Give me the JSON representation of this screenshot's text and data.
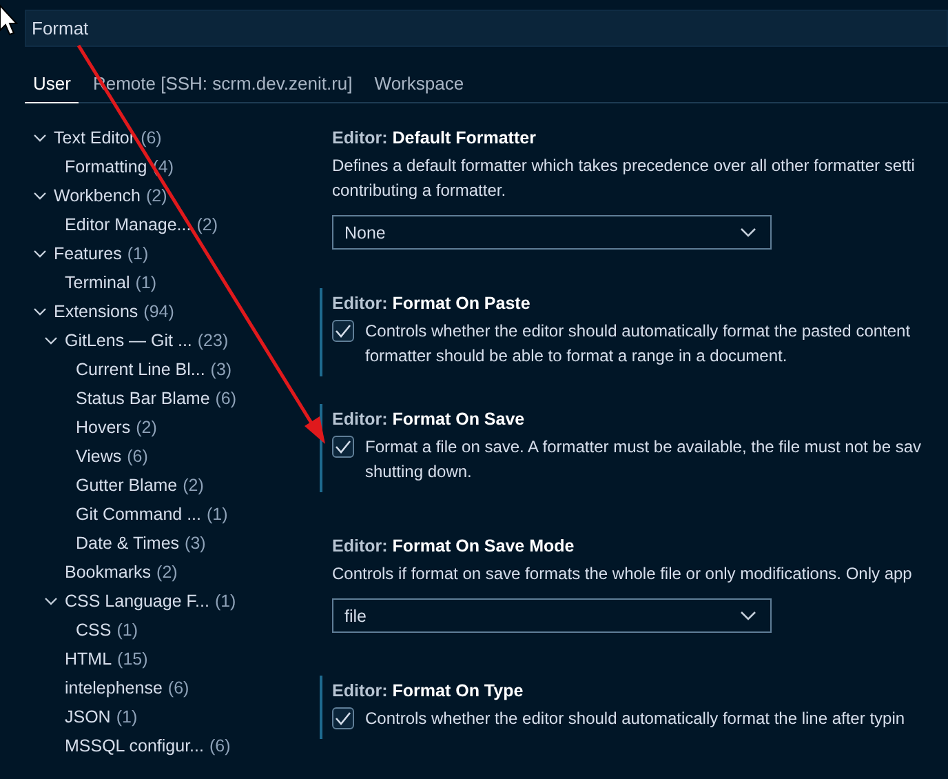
{
  "search": {
    "value": "Format"
  },
  "tabs": [
    {
      "label": "User",
      "selected": true
    },
    {
      "label": "Remote [SSH: scrm.dev.zenit.ru]",
      "selected": false
    },
    {
      "label": "Workspace",
      "selected": false
    }
  ],
  "tree": [
    {
      "label": "Text Editor",
      "count": "(6)",
      "expanded": true,
      "children": [
        {
          "label": "Formatting",
          "count": "(4)"
        }
      ]
    },
    {
      "label": "Workbench",
      "count": "(2)",
      "expanded": true,
      "children": [
        {
          "label": "Editor Manage...",
          "count": "(2)"
        }
      ]
    },
    {
      "label": "Features",
      "count": "(1)",
      "expanded": true,
      "children": [
        {
          "label": "Terminal",
          "count": "(1)"
        }
      ]
    },
    {
      "label": "Extensions",
      "count": "(94)",
      "expanded": true,
      "children": [
        {
          "label": "GitLens — Git ...",
          "count": "(23)",
          "expanded": true,
          "children": [
            {
              "label": "Current Line Bl...",
              "count": "(3)"
            },
            {
              "label": "Status Bar Blame",
              "count": "(6)"
            },
            {
              "label": "Hovers",
              "count": "(2)"
            },
            {
              "label": "Views",
              "count": "(6)"
            },
            {
              "label": "Gutter Blame",
              "count": "(2)"
            },
            {
              "label": "Git Command ...",
              "count": "(1)"
            },
            {
              "label": "Date & Times",
              "count": "(3)"
            }
          ]
        },
        {
          "label": "Bookmarks",
          "count": "(2)"
        },
        {
          "label": "CSS Language F...",
          "count": "(1)",
          "expanded": true,
          "children": [
            {
              "label": "CSS",
              "count": "(1)"
            }
          ]
        },
        {
          "label": "HTML",
          "count": "(15)"
        },
        {
          "label": "intelephense",
          "count": "(6)"
        },
        {
          "label": "JSON",
          "count": "(1)"
        },
        {
          "label": "MSSQL configur...",
          "count": "(6)"
        }
      ]
    }
  ],
  "settings": [
    {
      "kind": "select",
      "category": "Editor:",
      "name": "Default Formatter",
      "modified": false,
      "description": [
        "Defines a default formatter which takes precedence over all other formatter setti",
        "contributing a formatter."
      ],
      "value": "None"
    },
    {
      "kind": "checkbox",
      "category": "Editor:",
      "name": "Format On Paste",
      "modified": true,
      "checked": true,
      "description": [
        "Controls whether the editor should automatically format the pasted content",
        "formatter should be able to format a range in a document."
      ]
    },
    {
      "kind": "checkbox",
      "category": "Editor:",
      "name": "Format On Save",
      "modified": true,
      "checked": true,
      "description": [
        "Format a file on save. A formatter must be available, the file must not be sav",
        "shutting down."
      ]
    },
    {
      "kind": "select",
      "category": "Editor:",
      "name": "Format On Save Mode",
      "modified": false,
      "description": [
        "Controls if format on save formats the whole file or only modifications. Only app"
      ],
      "value": "file"
    },
    {
      "kind": "checkbox",
      "category": "Editor:",
      "name": "Format On Type",
      "modified": true,
      "checked": true,
      "description": [
        "Controls whether the editor should automatically format the line after typin"
      ]
    }
  ]
}
